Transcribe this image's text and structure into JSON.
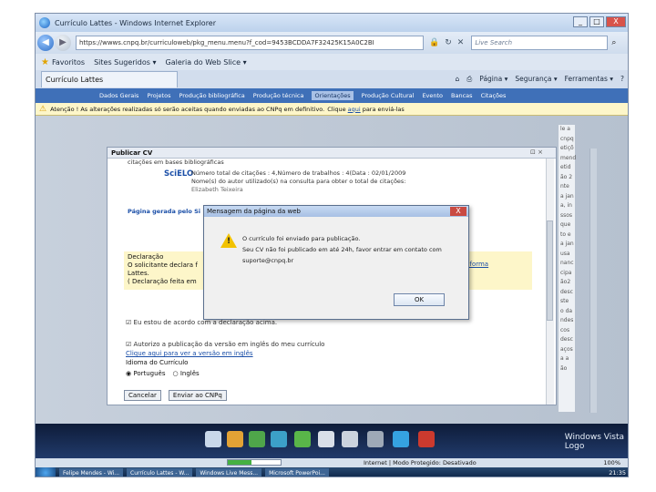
{
  "browser": {
    "title": "Currículo Lattes - Windows Internet Explorer",
    "url": "https://wwws.cnpq.br/curriculoweb/pkg_menu.menu?f_cod=9453BCDDA7F32425K15A0C2BI",
    "search_placeholder": "Live Search",
    "win_min": "_",
    "win_max": "□",
    "win_close": "X"
  },
  "favorites_bar": {
    "label": "Favoritos",
    "items": [
      "Sites Sugeridos ▾",
      "Galeria do Web Slice ▾"
    ]
  },
  "tab": {
    "label": "Currículo Lattes"
  },
  "commandbar": [
    "Página ▾",
    "Segurança ▾",
    "Ferramentas ▾"
  ],
  "menu": [
    "Dados Gerais",
    "Projetos",
    "Produção bibliográfica",
    "Produção técnica",
    "Orientações",
    "Produção Cultural",
    "Evento",
    "Bancas",
    "Citações"
  ],
  "notice": {
    "text": "Atenção ! As alterações realizadas só serão aceitas quando enviadas ao CNPq em definitivo.",
    "click": "Clique",
    "link": "aqui",
    "tail": "para enviá-las"
  },
  "panel": {
    "title": "Publicar CV",
    "close": "⊡ ×",
    "cut_text": "citações em bases bibliográficas",
    "scielo": "SciELO",
    "scielo_info": [
      "Número total de citações : 4,Número de trabalhos : 4(Data : 02/01/2009",
      "Nome(s) do autor utilizado(s) na consulta para obter o total de citações:"
    ],
    "author": "Elizabeth Teixeira",
    "page_generated": "Página gerada pelo Si",
    "decl_title": "Declaração",
    "decl_line1": "O solicitante declara f",
    "decl_line2": "Lattes.",
    "decl_line3": "( Declaração feita em",
    "platform_link": "Plataforma",
    "check1": "Eu estou de acordo com a declaração acima.",
    "check2": "Autorizo a publicação da versão em inglês do meu currículo",
    "link_english": "Clique aqui para ver a versão em inglês",
    "language_label": "Idioma do Currículo",
    "radio_pt": "Português",
    "radio_en": "Inglês",
    "cancel": "Cancelar",
    "send": "Enviar ao CNPq"
  },
  "dialog": {
    "title": "Mensagem da página da web",
    "close": "X",
    "line1": "O currículo foi enviado para publicação.",
    "line2": "Seu CV não foi publicado em até 24h, favor entrar em contato com",
    "line3": "suporte@cnpq.br",
    "ok": "OK"
  },
  "right_strip": [
    "le a",
    "cnpq",
    "etiçõ",
    "mend",
    "etid",
    "ão 2",
    "nte",
    "a jan",
    "a, in",
    "ssos",
    "que",
    "to e",
    "a jan",
    "usa",
    "nanc",
    "cipa",
    "ão2",
    "desc",
    "ste",
    "o da",
    "ndes",
    "cos",
    "desc",
    "aços",
    "a a",
    "ão"
  ],
  "windows_logo": {
    "line1": "Windows Vista",
    "line2": "Logo"
  },
  "status_bar": {
    "zone": "Internet | Modo Protegido: Desativado",
    "zoom": "100%",
    "progress": 0.45
  },
  "taskbar": {
    "tasks": [
      "Felipe Mendes - Wi...",
      "Currículo Lattes - W...",
      "Windows Live Mess...",
      "Microsoft PowerPoi..."
    ],
    "clock": "21:35"
  },
  "colors": {
    "menu_bg": "#3f70b8",
    "notice_bg": "#fdf6c9",
    "link": "#1b4fa8"
  }
}
